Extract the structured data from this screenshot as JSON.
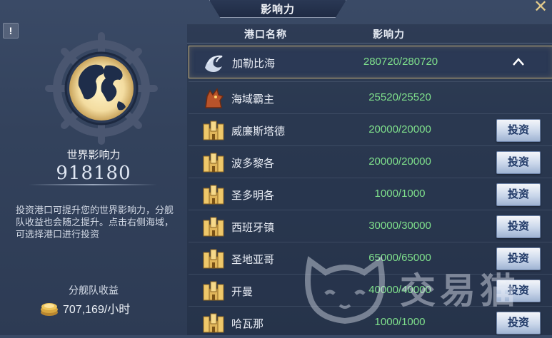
{
  "header": {
    "title": "影响力",
    "close_icon": "close-icon"
  },
  "left_panel": {
    "info_icon": "!",
    "world_influence_label": "世界影响力",
    "world_influence_value": "918180",
    "description": "投资港口可提升您的世界影响力，分舰队收益也会随之提升。点击右侧海域，可选择港口进行投资",
    "fleet_income_label": "分舰队收益",
    "fleet_income_value": "707,169/小时"
  },
  "table": {
    "col_port": "港口名称",
    "col_influence": "影响力",
    "invest_label": "投资",
    "region": {
      "name": "加勒比海",
      "value": "280720/280720",
      "icon": "wave-crest-icon",
      "expanded": true
    },
    "rows": [
      {
        "name": "海域霸主",
        "value": "25520/25520",
        "icon": "dragon-head-icon",
        "invest": false
      },
      {
        "name": "威廉斯塔德",
        "value": "20000/20000",
        "icon": "castle-icon",
        "invest": true
      },
      {
        "name": "波多黎各",
        "value": "20000/20000",
        "icon": "castle-icon",
        "invest": true
      },
      {
        "name": "圣多明各",
        "value": "1000/1000",
        "icon": "castle-icon",
        "invest": true
      },
      {
        "name": "西班牙镇",
        "value": "30000/30000",
        "icon": "castle-icon",
        "invest": true
      },
      {
        "name": "圣地亚哥",
        "value": "65000/65000",
        "icon": "castle-icon",
        "invest": true
      },
      {
        "name": "开曼",
        "value": "40000/40000",
        "icon": "castle-icon",
        "invest": true
      },
      {
        "name": "哈瓦那",
        "value": "1000/1000",
        "icon": "castle-icon",
        "invest": true
      }
    ]
  },
  "watermark": {
    "text": "交易猫"
  },
  "colors": {
    "value_green": "#7fe08c",
    "gold": "#e0c98b",
    "button_text": "#1f3866"
  }
}
